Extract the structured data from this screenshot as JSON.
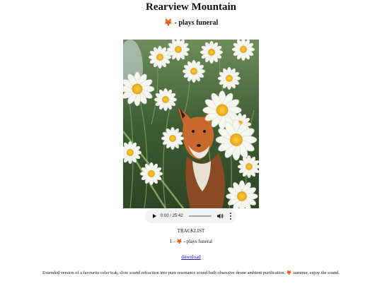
{
  "title": "Rearview Mountain",
  "subtitle": {
    "prefix_icon": "🦊",
    "text": " - plays funeral"
  },
  "cover": {
    "alt": "fox among daisies",
    "icon": "album-cover-image"
  },
  "player": {
    "time": "0:00 / 25:42",
    "progress": 0,
    "icons": [
      "play-icon",
      "seek-bar",
      "volume-icon",
      "more-options-icon"
    ]
  },
  "tracklist": {
    "heading": "TRACKLIST",
    "items": [
      {
        "number": "1 - ",
        "icon": "🦊",
        "title": " - plays funeral"
      }
    ]
  },
  "download": {
    "label": "download"
  },
  "description": {
    "before": "Extended version of a favourite celer trak, slow sound refraction into pure resonance sound bath obsessive drone ambient purification. ",
    "icon": "🦊",
    "after": " summer, enjoy the sound."
  },
  "colors": {
    "link": "#1a0dab",
    "player_bg": "#f1f3f4",
    "fox_emoji": "#e8762a"
  }
}
